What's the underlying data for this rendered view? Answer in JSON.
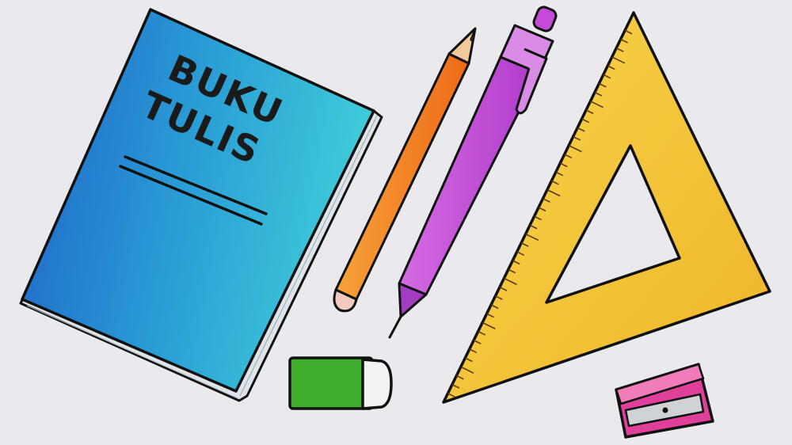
{
  "image": {
    "background_color": "#e9e9ee"
  },
  "book": {
    "title_line1": "BUKU",
    "title_line2": "TULIS",
    "cover_colors": [
      "#1f6fd0",
      "#2aa6d8",
      "#35c8d8"
    ],
    "page_edge_color": "#dfe4ea"
  },
  "pencil": {
    "body_color": "#f2781e",
    "eraser_color": "#f3c9c0",
    "tip_color": "#f1c99a"
  },
  "pen": {
    "body_color": "#c64ad8",
    "cap_color": "#d98be6"
  },
  "set_square": {
    "color": "#f3c431"
  },
  "eraser": {
    "body_color": "#3fae2c",
    "sleeve_color": "#f2f2f2"
  },
  "sharpener": {
    "body_color": "#e0409a",
    "blade_color": "#cfd3d6"
  }
}
